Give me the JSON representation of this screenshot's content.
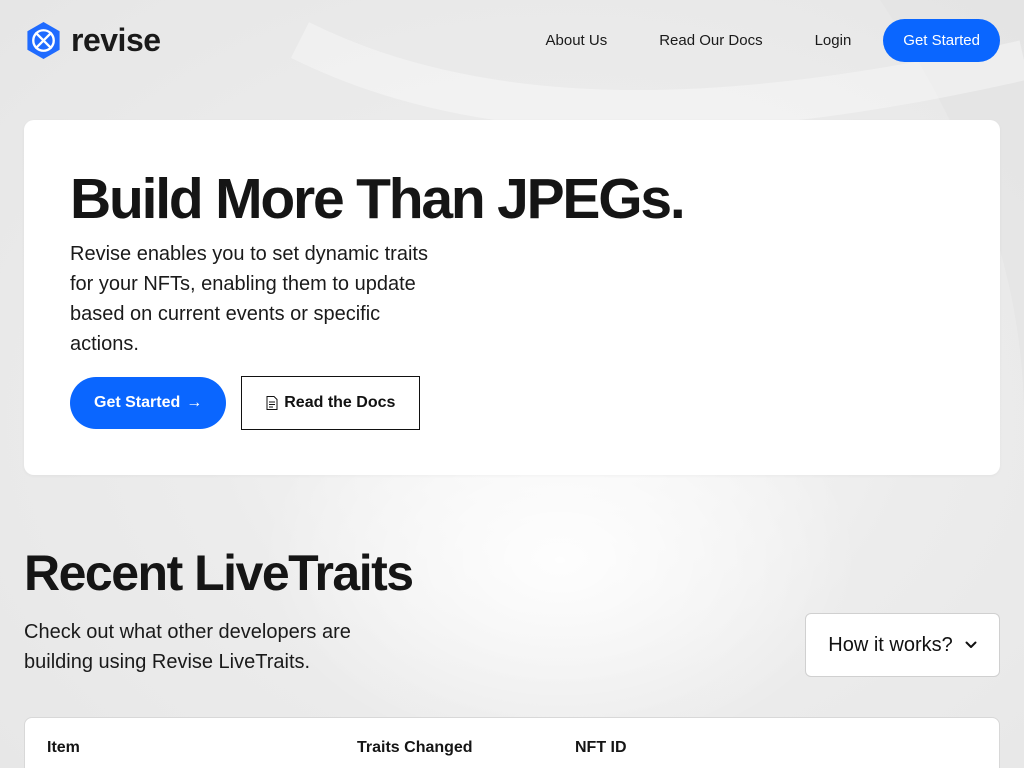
{
  "brand": {
    "name": "revise",
    "logo_icon": "revise-logo-icon"
  },
  "nav": {
    "about": "About Us",
    "docs": "Read Our Docs",
    "login": "Login",
    "cta": "Get Started"
  },
  "hero": {
    "title": "Build More Than JPEGs.",
    "description": "Revise enables you to set dynamic traits for your NFTs, enabling them to update based on current events or specific actions.",
    "primary_button": "Get Started",
    "primary_arrow": "→",
    "secondary_button": "Read the Docs"
  },
  "recent": {
    "title": "Recent LiveTraits",
    "description": "Check out what other developers are building using Revise LiveTraits.",
    "how_button": "How it works?"
  },
  "table": {
    "columns": [
      "Item",
      "Traits Changed",
      "NFT ID"
    ]
  },
  "colors": {
    "accent": "#0a66ff",
    "background": "#ececec",
    "card": "#ffffff",
    "text": "#151515"
  }
}
